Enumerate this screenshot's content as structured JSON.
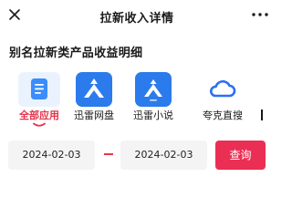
{
  "header": {
    "title": "拉新收入详情"
  },
  "section": {
    "title": "别名拉新类产品收益明细"
  },
  "apps": [
    {
      "label": "全部应用",
      "icon": "document-list-icon",
      "selected": true
    },
    {
      "label": "迅雷网盘",
      "icon": "xunlei-bird-icon",
      "selected": false
    },
    {
      "label": "迅雷小说",
      "icon": "xunlei-novel-icon",
      "selected": false
    },
    {
      "label": "夸克直搜",
      "icon": "quark-cloud-icon",
      "selected": false
    }
  ],
  "filter": {
    "start_date": "2024-02-03",
    "end_date": "2024-02-03",
    "query_label": "查询"
  },
  "colors": {
    "accent": "#e5354c",
    "button": "#eb2f54",
    "brand_blue": "#2b7bec"
  }
}
